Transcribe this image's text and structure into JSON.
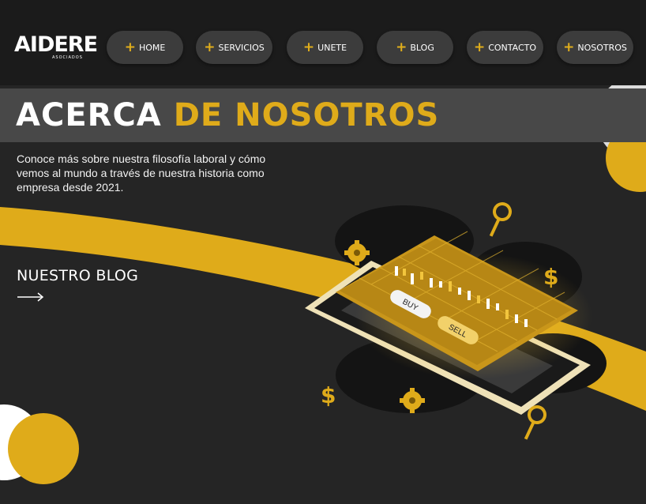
{
  "logo": {
    "name": "AIDERE",
    "sub": "ASOCIADOS"
  },
  "nav": [
    {
      "label": "HOME"
    },
    {
      "label": "SERVICIOS"
    },
    {
      "label": "UNETE"
    },
    {
      "label": "BLOG"
    },
    {
      "label": "CONTACTO"
    },
    {
      "label": "NOSOTROS"
    }
  ],
  "hero": {
    "title_white": "ACERCA",
    "title_yellow": "DE NOSOTROS",
    "description": "Conoce más sobre nuestra filosofía laboral y cómo vemos al mundo a través de nuestra historia como empresa desde 2021.",
    "blog_link": "NUESTRO BLOG"
  },
  "illustration": {
    "buy_label": "BUY",
    "sell_label": "SELL"
  },
  "colors": {
    "accent": "#dfab1a",
    "background": "#252525",
    "nav_bg": "#3c3c3c",
    "band": "#484848"
  }
}
